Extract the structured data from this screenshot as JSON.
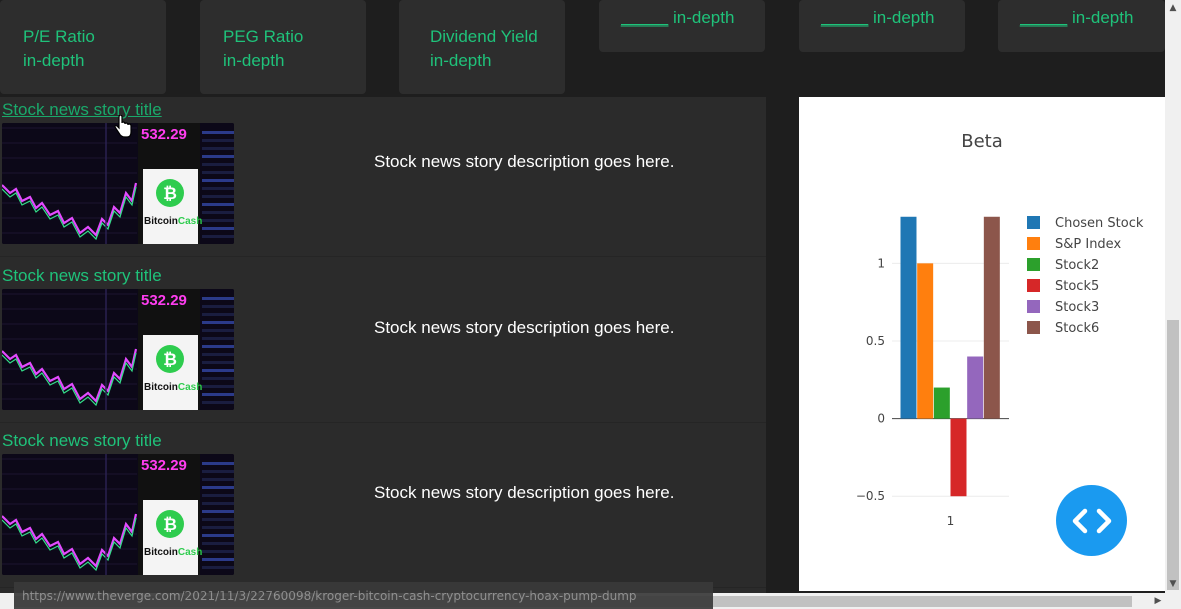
{
  "cards": [
    {
      "line1": "P/E Ratio",
      "line2": "in-depth"
    },
    {
      "line1": "PEG Ratio",
      "line2": "in-depth"
    },
    {
      "line1": "Dividend Yield",
      "line2": "in-depth"
    },
    {
      "blank": "_____",
      "line1": " in-depth"
    },
    {
      "blank": "_____",
      "line1": " in-depth"
    },
    {
      "blank": "_____",
      "line1": " in-depth"
    }
  ],
  "news": [
    {
      "title": "Stock news story title",
      "description": "Stock news story description goes here."
    },
    {
      "title": "Stock news story title",
      "description": "Stock news story description goes here."
    },
    {
      "title": "Stock news story title",
      "description": "Stock news story description goes here."
    }
  ],
  "thumbnail": {
    "price": "532.29",
    "brand": "BitcoinCash",
    "brand_part1": "Bitcoin",
    "brand_part2": "Cash"
  },
  "status_url": "https://www.theverge.com/2021/11/3/22760098/kroger-bitcoin-cash-cryptocurrency-hoax-pump-dump",
  "fab": {
    "icon": "code-icon"
  },
  "chart_data": {
    "type": "bar",
    "title": "Beta",
    "categories": [
      "1"
    ],
    "series": [
      {
        "name": "Chosen Stock",
        "values": [
          1.3
        ],
        "color": "#1f77b4"
      },
      {
        "name": "S&P Index",
        "values": [
          1.0
        ],
        "color": "#ff7f0e"
      },
      {
        "name": "Stock2",
        "values": [
          0.2
        ],
        "color": "#2ca02c"
      },
      {
        "name": "Stock5",
        "values": [
          -0.5
        ],
        "color": "#d62728"
      },
      {
        "name": "Stock3",
        "values": [
          0.4
        ],
        "color": "#9467bd"
      },
      {
        "name": "Stock6",
        "values": [
          1.3
        ],
        "color": "#8c564b"
      }
    ],
    "yticks": [
      "1",
      "0.5",
      "0",
      "−0.5"
    ],
    "ytick_values": [
      1,
      0.5,
      0,
      -0.5
    ],
    "ylim": [
      -0.5,
      1.3
    ],
    "grid": true,
    "legend_position": "right"
  },
  "colors": {
    "accent": "#1fc27a",
    "fab": "#1a9af0",
    "background": "#1e1e1e",
    "panel": "#2b2b2b"
  }
}
